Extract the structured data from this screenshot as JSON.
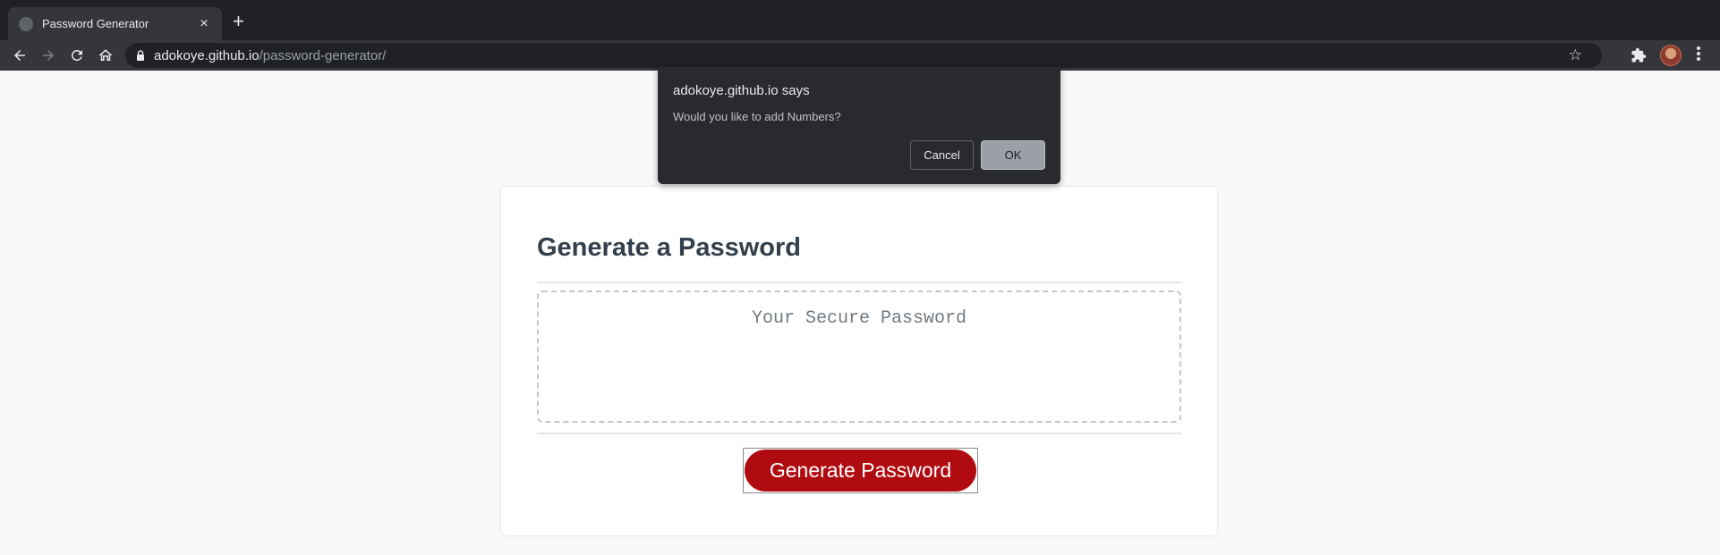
{
  "browser": {
    "tab": {
      "title": "Password Generator",
      "close_label": "×"
    },
    "new_tab_label": "+",
    "address": {
      "host": "adokoye.github.io",
      "path": "/password-generator/"
    }
  },
  "page": {
    "title": "Generate a Password",
    "password_placeholder": "Your Secure Password",
    "generate_button": "Generate Password"
  },
  "dialog": {
    "title": "adokoye.github.io says",
    "message": "Would you like to add Numbers?",
    "cancel_label": "Cancel",
    "ok_label": "OK"
  },
  "colors": {
    "accent_button": "#b00b10",
    "chrome_dark": "#202124",
    "heading": "#333f4b"
  },
  "icons": [
    "back-arrow-icon",
    "forward-arrow-icon",
    "reload-icon",
    "home-icon",
    "lock-icon",
    "star-icon",
    "puzzle-extension-icon",
    "menu-dots-icon"
  ]
}
